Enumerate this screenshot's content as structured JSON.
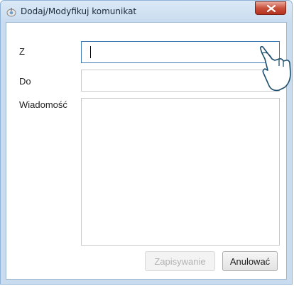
{
  "window": {
    "title": "Dodaj/Modyfikuj komunikat"
  },
  "form": {
    "from_label": "Z",
    "from_value": "",
    "to_label": "Do",
    "to_value": "",
    "message_label": "Wiadomość",
    "message_value": ""
  },
  "buttons": {
    "save_label": "Zapisywanie",
    "cancel_label": "Anulować"
  },
  "icons": {
    "app": "app-icon",
    "close": "close-icon",
    "cursor": "hand-pointer-icon"
  },
  "colors": {
    "close_button": "#c8503b",
    "active_border": "#3d7ab3"
  }
}
